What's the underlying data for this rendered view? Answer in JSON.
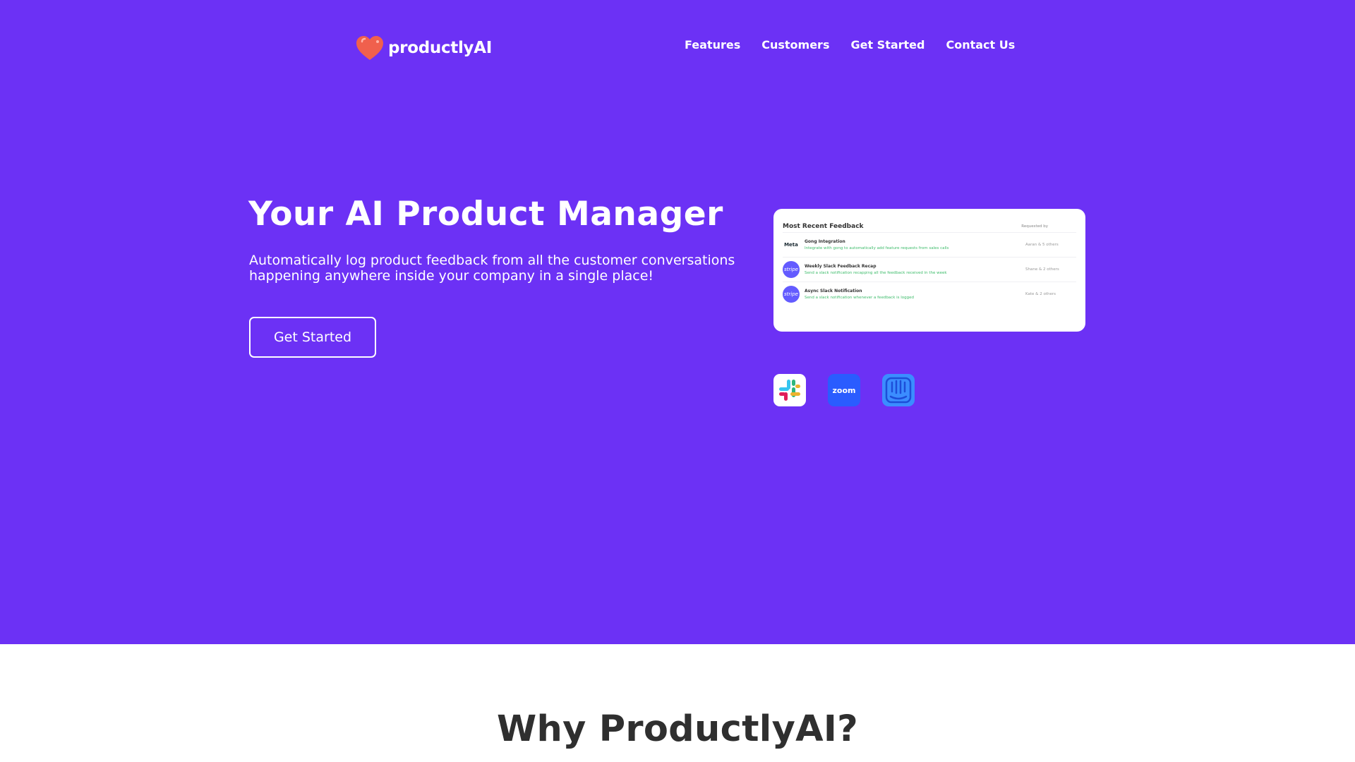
{
  "brand": {
    "name": "productlyAI",
    "logo_icon": "heart-icon",
    "accent": "#6c31f5",
    "logo_color": "#f0604d"
  },
  "nav": {
    "items": [
      "Features",
      "Customers",
      "Get Started",
      "Contact Us"
    ]
  },
  "hero": {
    "title": "Your AI Product Manager",
    "subtitle": "Automatically log product feedback from all the customer conversations happening anywhere inside your company in a single place!",
    "cta_label": "Get Started"
  },
  "feedback_card": {
    "title": "Most Recent Feedback",
    "column_label": "Requested by",
    "rows": [
      {
        "logo": "Meta",
        "logo_icon": "meta-icon",
        "title": "Gong Integration",
        "description": "Integrate with gong to automatically add feature requests from sales calls",
        "requested_by": "Aaran & 5 others"
      },
      {
        "logo": "stripe",
        "logo_icon": "stripe-icon",
        "title": "Weekly Slack Feedback Recap",
        "description": "Send a slack notification recapping all the feedback received in the week",
        "requested_by": "Shane & 2 others"
      },
      {
        "logo": "stripe",
        "logo_icon": "stripe-icon",
        "title": "Async Slack Notification",
        "description": "Send a slack notification whenever a feedback is logged",
        "requested_by": "Kate & 2 others"
      }
    ]
  },
  "integrations": [
    {
      "name": "slack",
      "icon": "slack-icon"
    },
    {
      "name": "zoom",
      "icon": "zoom-icon",
      "label": "zoom"
    },
    {
      "name": "intercom",
      "icon": "intercom-icon"
    }
  ],
  "why_section": {
    "title": "Why ProductlyAI?"
  }
}
